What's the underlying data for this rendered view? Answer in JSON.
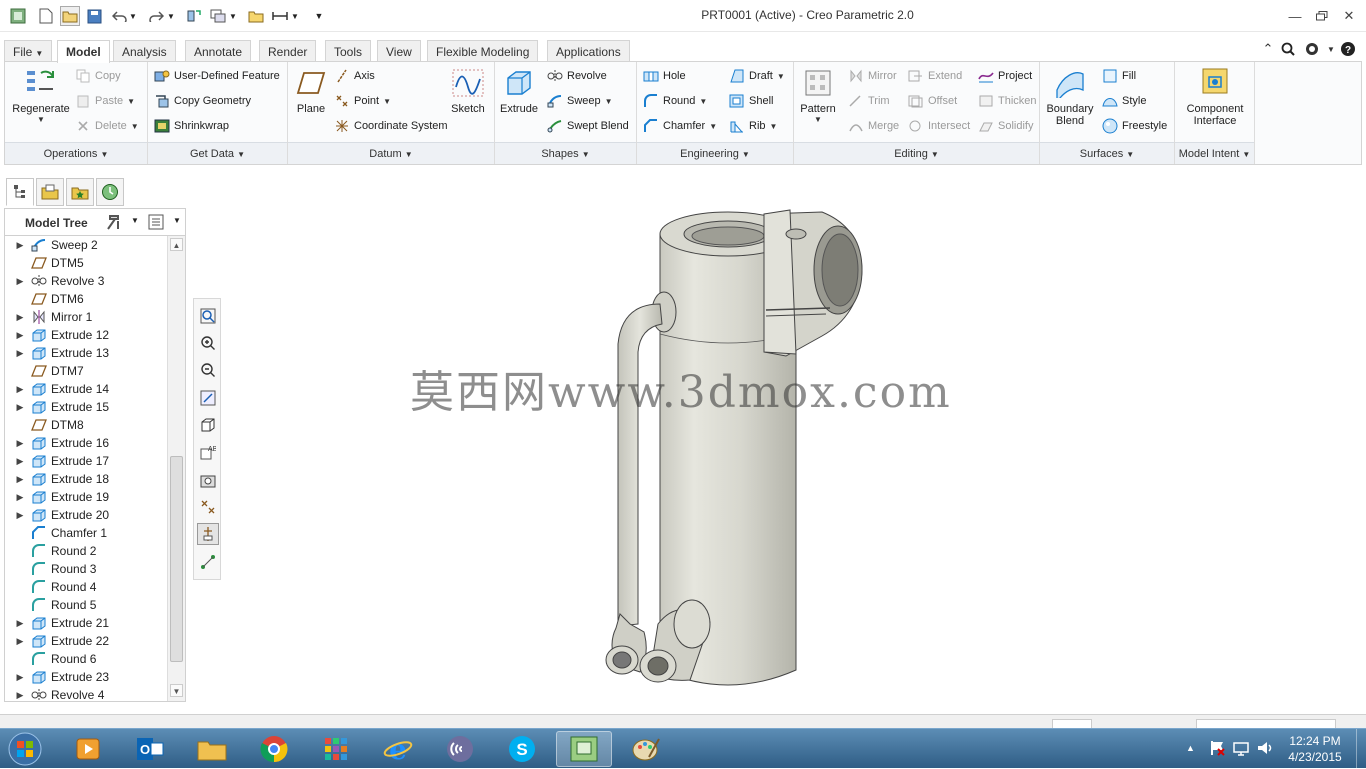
{
  "window": {
    "title": "PRT0001 (Active) - Creo Parametric 2.0"
  },
  "tabs": [
    {
      "label": "File"
    },
    {
      "label": "Model"
    },
    {
      "label": "Analysis"
    },
    {
      "label": "Annotate"
    },
    {
      "label": "Render"
    },
    {
      "label": "Tools"
    },
    {
      "label": "View"
    },
    {
      "label": "Flexible Modeling"
    },
    {
      "label": "Applications"
    }
  ],
  "ribbon": {
    "operations": {
      "label": "Operations",
      "regenerate": "Regenerate",
      "copy": "Copy",
      "paste": "Paste",
      "delete": "Delete"
    },
    "get_data": {
      "label": "Get Data",
      "udf": "User-Defined Feature",
      "copy_geometry": "Copy Geometry",
      "shrinkwrap": "Shrinkwrap"
    },
    "datum": {
      "label": "Datum",
      "plane": "Plane",
      "axis": "Axis",
      "point": "Point",
      "csys": "Coordinate System",
      "sketch": "Sketch"
    },
    "shapes": {
      "label": "Shapes",
      "extrude": "Extrude",
      "revolve": "Revolve",
      "sweep": "Sweep",
      "swept_blend": "Swept Blend"
    },
    "engineering": {
      "label": "Engineering",
      "hole": "Hole",
      "round": "Round",
      "chamfer": "Chamfer",
      "draft": "Draft",
      "shell": "Shell",
      "rib": "Rib"
    },
    "editing": {
      "label": "Editing",
      "pattern": "Pattern",
      "mirror": "Mirror",
      "trim": "Trim",
      "merge": "Merge",
      "extend": "Extend",
      "offset": "Offset",
      "intersect": "Intersect",
      "project": "Project",
      "thicken": "Thicken",
      "solidify": "Solidify"
    },
    "surfaces": {
      "label": "Surfaces",
      "boundary_blend_1": "Boundary",
      "boundary_blend_2": "Blend",
      "fill": "Fill",
      "style": "Style",
      "freestyle": "Freestyle"
    },
    "model_intent": {
      "label": "Model Intent",
      "component_interface_1": "Component",
      "component_interface_2": "Interface"
    }
  },
  "model_tree": {
    "header": "Model Tree",
    "items": [
      {
        "label": "Sweep 2",
        "icon": "sweep-icon",
        "expandable": true
      },
      {
        "label": "DTM5",
        "icon": "datum-plane-icon",
        "expandable": false
      },
      {
        "label": "Revolve 3",
        "icon": "revolve-icon",
        "expandable": true
      },
      {
        "label": "DTM6",
        "icon": "datum-plane-icon",
        "expandable": false
      },
      {
        "label": "Mirror 1",
        "icon": "mirror-icon",
        "expandable": true
      },
      {
        "label": "Extrude 12",
        "icon": "extrude-icon",
        "expandable": true
      },
      {
        "label": "Extrude 13",
        "icon": "extrude-icon",
        "expandable": true
      },
      {
        "label": "DTM7",
        "icon": "datum-plane-icon",
        "expandable": false
      },
      {
        "label": "Extrude 14",
        "icon": "extrude-icon",
        "expandable": true
      },
      {
        "label": "Extrude 15",
        "icon": "extrude-icon",
        "expandable": true
      },
      {
        "label": "DTM8",
        "icon": "datum-plane-icon",
        "expandable": false
      },
      {
        "label": "Extrude 16",
        "icon": "extrude-icon",
        "expandable": true
      },
      {
        "label": "Extrude 17",
        "icon": "extrude-icon",
        "expandable": true
      },
      {
        "label": "Extrude 18",
        "icon": "extrude-icon",
        "expandable": true
      },
      {
        "label": "Extrude 19",
        "icon": "extrude-icon",
        "expandable": true
      },
      {
        "label": "Extrude 20",
        "icon": "extrude-icon",
        "expandable": true
      },
      {
        "label": "Chamfer 1",
        "icon": "chamfer-icon",
        "expandable": false
      },
      {
        "label": "Round 2",
        "icon": "round-icon",
        "expandable": false
      },
      {
        "label": "Round 3",
        "icon": "round-icon",
        "expandable": false
      },
      {
        "label": "Round 4",
        "icon": "round-icon",
        "expandable": false
      },
      {
        "label": "Round 5",
        "icon": "round-icon",
        "expandable": false
      },
      {
        "label": "Extrude 21",
        "icon": "extrude-icon",
        "expandable": true
      },
      {
        "label": "Extrude 22",
        "icon": "extrude-icon",
        "expandable": true
      },
      {
        "label": "Round 6",
        "icon": "round-icon",
        "expandable": false
      },
      {
        "label": "Extrude 23",
        "icon": "extrude-icon",
        "expandable": true
      },
      {
        "label": "Revolve 4",
        "icon": "revolve-icon",
        "expandable": true
      }
    ]
  },
  "watermark": "莫西网www.3dmox.com",
  "taskbar": {
    "time": "12:24 PM",
    "date": "4/23/2015"
  }
}
